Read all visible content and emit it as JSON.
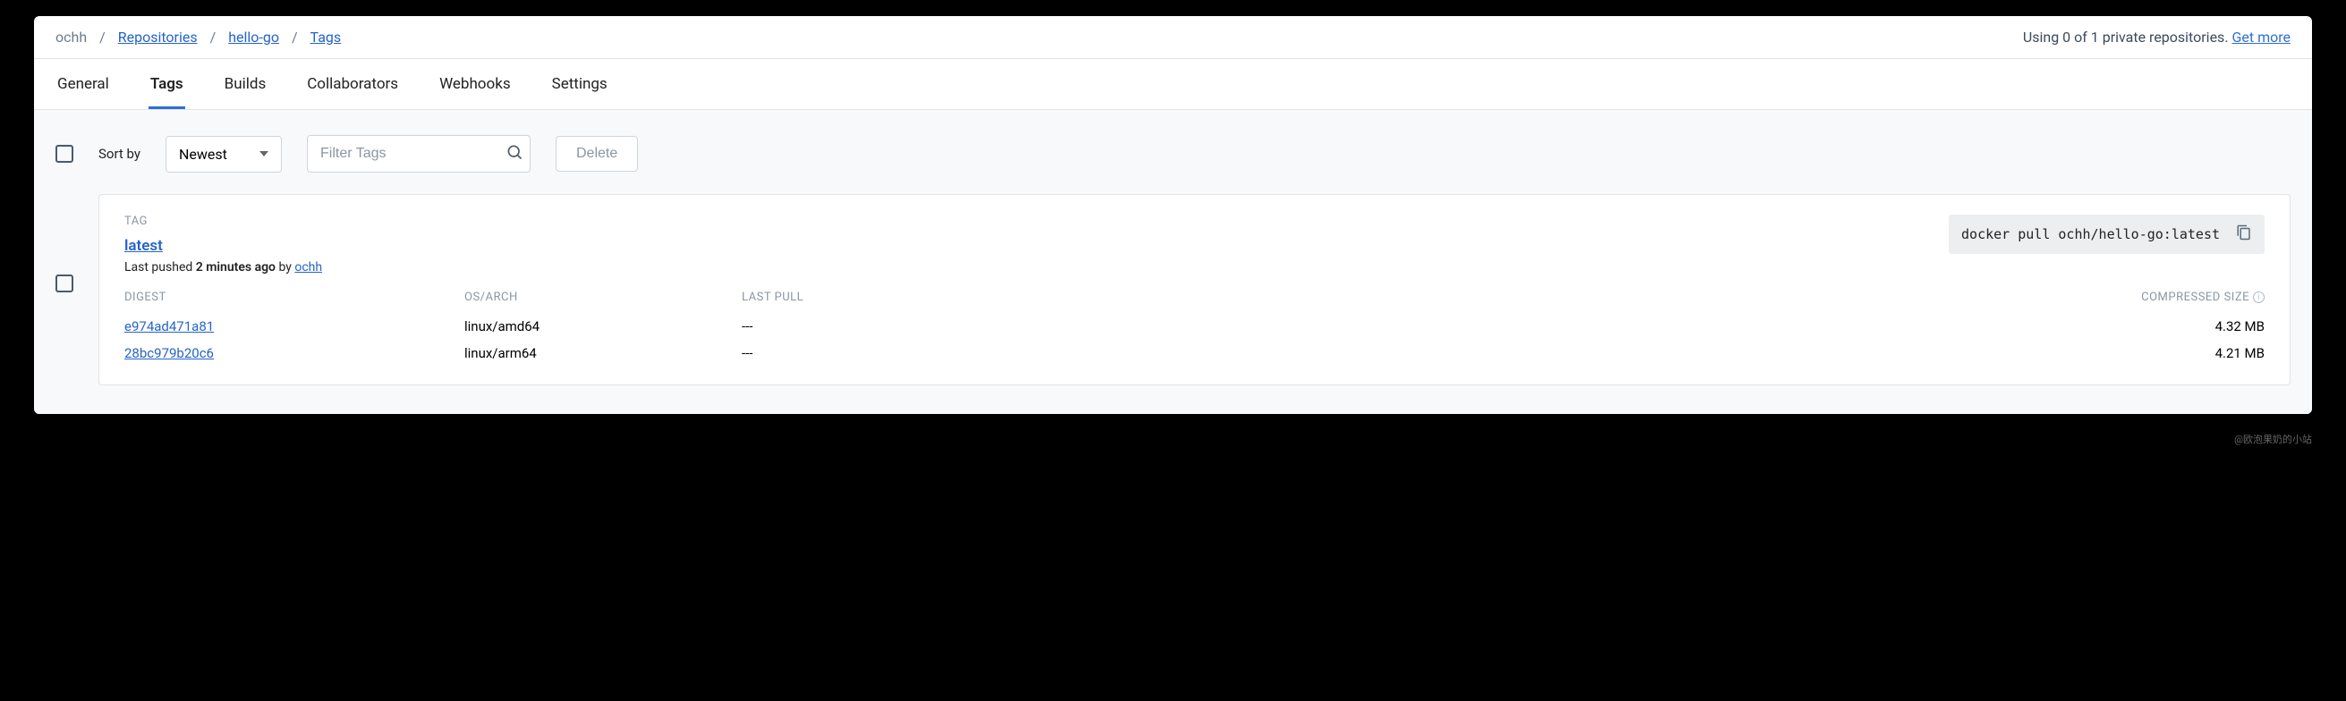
{
  "breadcrumb": {
    "user": "ochh",
    "repositories": "Repositories",
    "repo": "hello-go",
    "page": "Tags"
  },
  "quota": {
    "text": "Using 0 of 1 private repositories.",
    "link": "Get more"
  },
  "tabs": {
    "general": "General",
    "tags": "Tags",
    "builds": "Builds",
    "collaborators": "Collaborators",
    "webhooks": "Webhooks",
    "settings": "Settings"
  },
  "toolbar": {
    "sort_label": "Sort by",
    "sort_value": "Newest",
    "filter_placeholder": "Filter Tags",
    "delete_label": "Delete"
  },
  "card": {
    "tag_header": "TAG",
    "tag_name": "latest",
    "pushed_prefix": "Last pushed ",
    "pushed_time": "2 minutes ago",
    "pushed_by": " by ",
    "pushed_user": "ochh",
    "pull_command": "docker pull ochh/hello-go:latest",
    "headers": {
      "digest": "DIGEST",
      "osarch": "OS/ARCH",
      "lastpull": "LAST PULL",
      "size": "COMPRESSED SIZE"
    },
    "rows": [
      {
        "digest": "e974ad471a81",
        "osarch": "linux/amd64",
        "lastpull": "---",
        "size": "4.32 MB"
      },
      {
        "digest": "28bc979b20c6",
        "osarch": "linux/arm64",
        "lastpull": "---",
        "size": "4.21 MB"
      }
    ]
  },
  "watermark": "@欧泡果奶的小站"
}
